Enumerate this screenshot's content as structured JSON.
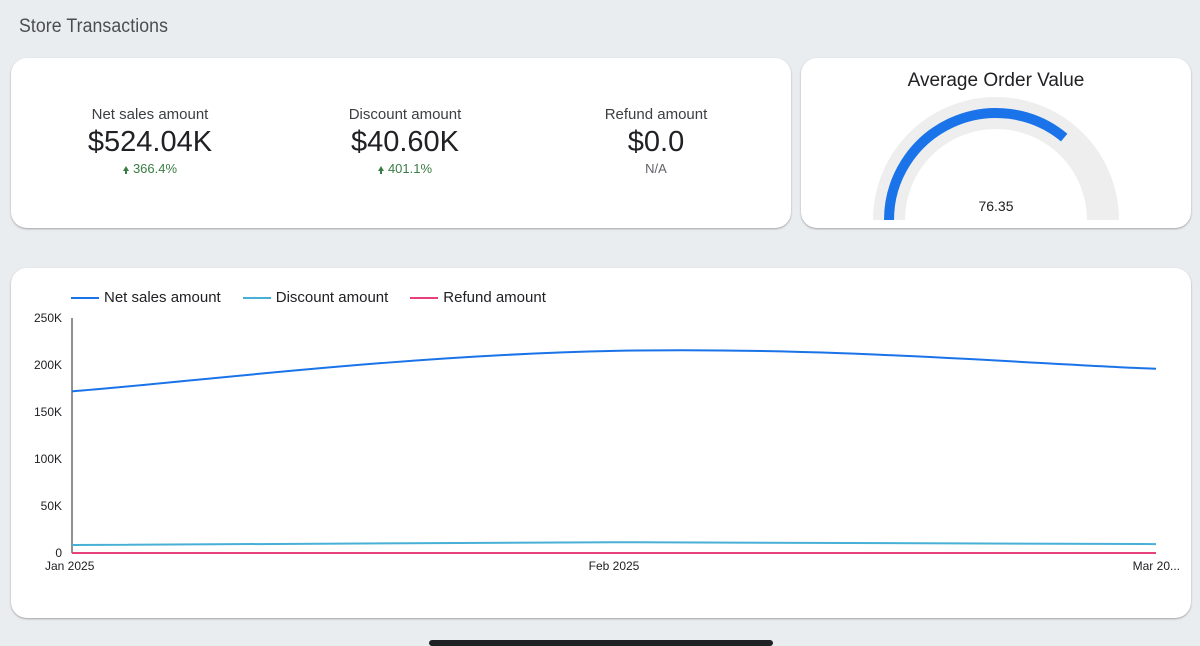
{
  "page": {
    "title": "Store Transactions"
  },
  "kpis": [
    {
      "label": "Net sales amount",
      "value": "$524.04K",
      "delta": "366.4%",
      "trend": "up"
    },
    {
      "label": "Discount amount",
      "value": "$40.60K",
      "delta": "401.1%",
      "trend": "up"
    },
    {
      "label": "Refund amount",
      "value": "$0.0",
      "delta": "N/A",
      "trend": "none"
    }
  ],
  "gauge": {
    "title": "Average Order Value",
    "value": 76.35,
    "value_label": "76.35",
    "fill_fraction": 0.72,
    "colors": {
      "track": "#eeeeee",
      "fill": "#1a73e8"
    }
  },
  "chart_data": {
    "type": "line",
    "x": [
      "Jan 2025",
      "Feb 2025",
      "Mar 20..."
    ],
    "ylim": [
      0,
      250000
    ],
    "yticks": [
      0,
      50000,
      100000,
      150000,
      200000,
      250000
    ],
    "ytick_labels": [
      "0",
      "50K",
      "100K",
      "150K",
      "200K",
      "250K"
    ],
    "legend_position": "top-left",
    "grid": false,
    "series": [
      {
        "name": "Net sales amount",
        "color": "#1a73e8",
        "values": [
          172000,
          215000,
          196000
        ]
      },
      {
        "name": "Discount amount",
        "color": "#48b0d6",
        "values": [
          8500,
          11500,
          9500
        ]
      },
      {
        "name": "Refund amount",
        "color": "#e8407d",
        "values": [
          0,
          0,
          0
        ]
      }
    ]
  }
}
